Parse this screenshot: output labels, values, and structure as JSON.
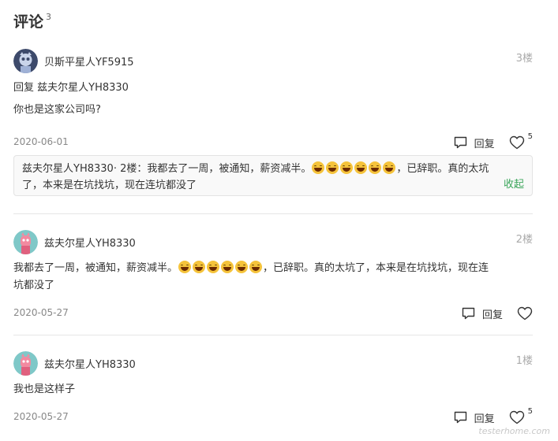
{
  "header": {
    "title": "评论",
    "count": "3"
  },
  "comments": [
    {
      "user": "贝斯平星人YF5915",
      "floor": "3楼",
      "reply_prefix": "回复",
      "reply_target": "兹夫尔星人YH8330",
      "text": "你也是这家公司吗?",
      "date": "2020-06-01",
      "reply_label": "回复",
      "likes": "5"
    },
    {
      "user": "兹夫尔星人YH8330",
      "floor": "2楼",
      "text_before": "我都去了一周，被通知，薪资减半。",
      "emoji_count": 6,
      "text_after_line1": "，已辞职。真的太坑了，本来是在坑找坑，现在连",
      "text_after_line2": "坑都没了",
      "date": "2020-05-27",
      "reply_label": "回复"
    },
    {
      "user": "兹夫尔星人YH8330",
      "floor": "1楼",
      "text": "我也是这样子",
      "date": "2020-05-27",
      "reply_label": "回复",
      "likes": "5"
    }
  ],
  "quote": {
    "author": "兹夫尔星人YH8330",
    "floor_tag": "· 2楼：",
    "text_before": "我都去了一周，被通知，薪资减半。",
    "text_after": "，已辞职。真的太坑",
    "text_line2": "了，本来是在坑找坑，现在连坑都没了",
    "collapse_label": "收起"
  },
  "watermark": "testerhome.com",
  "colors": {
    "accent_green": "#3aa55a",
    "muted": "#aaaaaa"
  }
}
